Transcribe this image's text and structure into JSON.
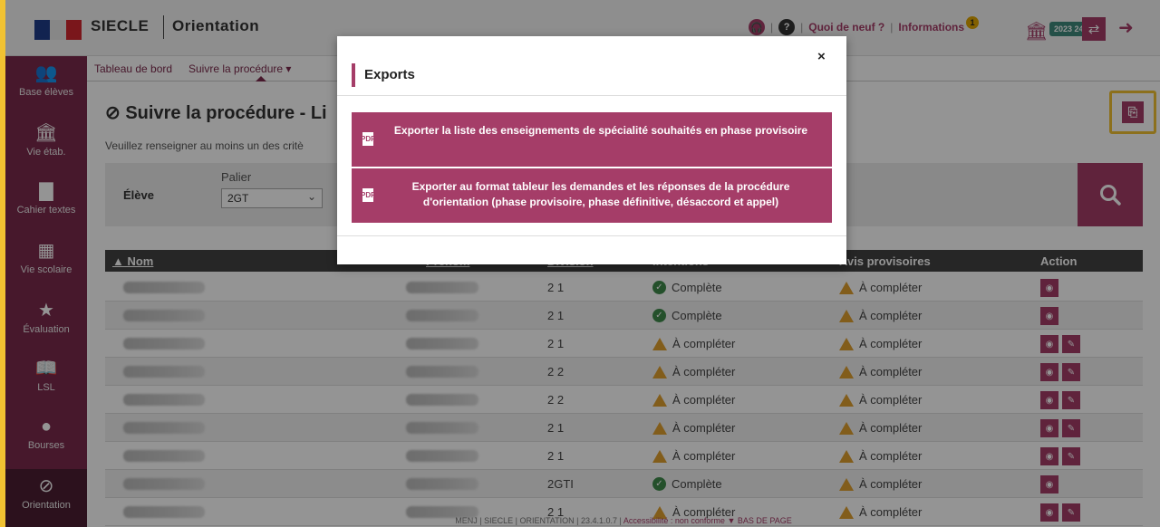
{
  "header": {
    "app_name": "SIECLE",
    "module_name": "Orientation",
    "whats_new": "Quoi de neuf ?",
    "informations": "Informations",
    "informations_badge": "1",
    "year": "2023 24"
  },
  "sidebar": {
    "items": [
      {
        "label": "Base élèves",
        "icon": "people-icon"
      },
      {
        "label": "Vie étab.",
        "icon": "bank-icon"
      },
      {
        "label": "Cahier textes",
        "icon": "book-icon"
      },
      {
        "label": "Vie scolaire",
        "icon": "calendar-icon"
      },
      {
        "label": "Évaluation",
        "icon": "star-icon"
      },
      {
        "label": "LSL",
        "icon": "open-book-icon"
      },
      {
        "label": "Bourses",
        "icon": "money-bag-icon"
      },
      {
        "label": "Orientation",
        "icon": "compass-icon"
      }
    ]
  },
  "menu": {
    "dashboard": "Tableau de bord",
    "follow": "Suivre la procédure ▾"
  },
  "page": {
    "title": "Suivre la procédure - Li",
    "subtitle": "Veuillez renseigner au moins un des critè"
  },
  "filter": {
    "student_label": "Élève",
    "palier_label": "Palier",
    "palier_value": "2GT"
  },
  "table": {
    "headers": {
      "nom": "▲ Nom",
      "prenom": "Prénom",
      "division": "Division",
      "intentions": "Intentions",
      "avis": "Avis provisoires",
      "action": "Action"
    },
    "rows": [
      {
        "division": "2 1",
        "intention": "Complète",
        "intention_status": "ok",
        "avis": "À compléter",
        "actions": 1
      },
      {
        "division": "2 1",
        "intention": "Complète",
        "intention_status": "ok",
        "avis": "À compléter",
        "actions": 1
      },
      {
        "division": "2 1",
        "intention": "À compléter",
        "intention_status": "warn",
        "avis": "À compléter",
        "actions": 2
      },
      {
        "division": "2 2",
        "intention": "À compléter",
        "intention_status": "warn",
        "avis": "À compléter",
        "actions": 2
      },
      {
        "division": "2 2",
        "intention": "À compléter",
        "intention_status": "warn",
        "avis": "À compléter",
        "actions": 2
      },
      {
        "division": "2 1",
        "intention": "À compléter",
        "intention_status": "warn",
        "avis": "À compléter",
        "actions": 2
      },
      {
        "division": "2 1",
        "intention": "À compléter",
        "intention_status": "warn",
        "avis": "À compléter",
        "actions": 2
      },
      {
        "division": "2GTI",
        "intention": "Complète",
        "intention_status": "ok",
        "avis": "À compléter",
        "actions": 1
      },
      {
        "division": "2 1",
        "intention": "À compléter",
        "intention_status": "warn",
        "avis": "À compléter",
        "actions": 2
      }
    ]
  },
  "footer": {
    "text": "MENJ | SIECLE | ORIENTATION | 23.4.1.0.7 |",
    "accessibility": "Accessibilité : non conforme",
    "bottom": "▼ BAS DE PAGE"
  },
  "modal": {
    "title": "Exports",
    "close": "×",
    "export1": "Exporter la liste des enseignements de spécialité souhaités en phase provisoire",
    "export2": "Exporter au format tableur les demandes et les réponses de la procédure d'orientation (phase provisoire, phase définitive, désaccord et appel)"
  },
  "colors": {
    "accent": "#a53d68",
    "sidebar": "#7b2a4c",
    "highlight": "#f1c232",
    "ok": "#3e8a4a",
    "warn": "#e0a030"
  }
}
